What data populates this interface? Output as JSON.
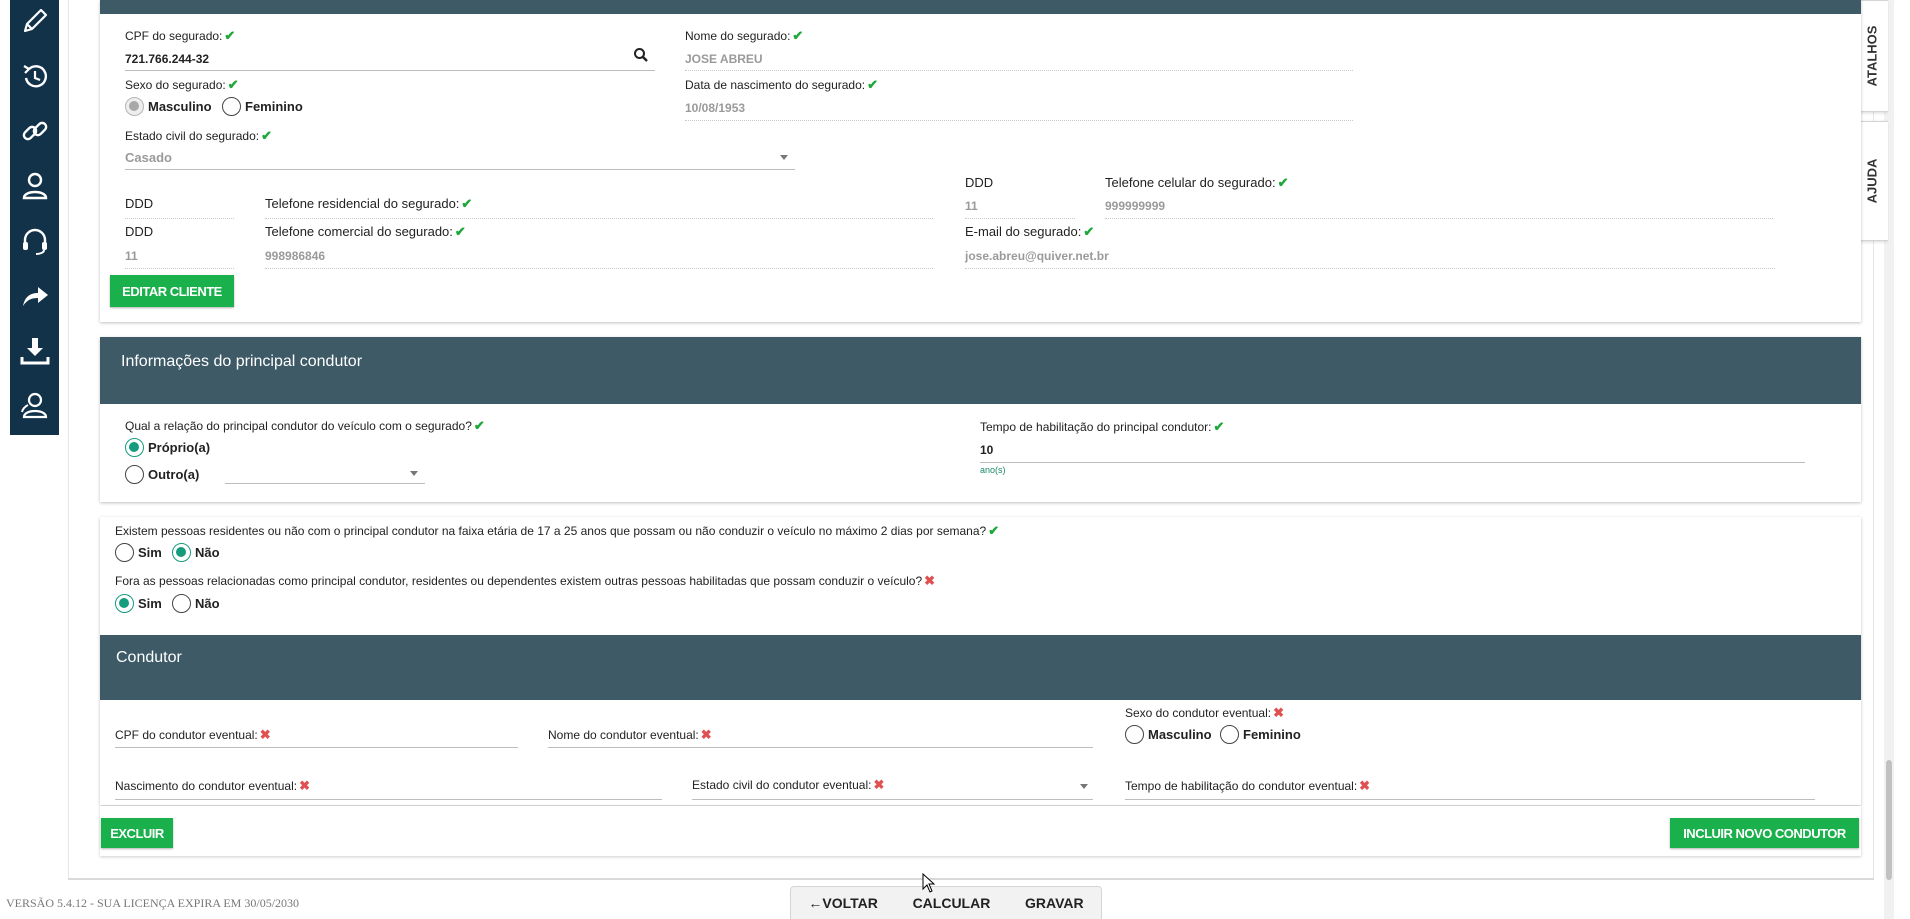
{
  "sidebar": {
    "icons": [
      "pencil-icon",
      "refresh-clock-icon",
      "link-icon",
      "user-icon",
      "headset-icon",
      "forward-arrow-icon",
      "download-icon",
      "users-icon"
    ]
  },
  "side_tabs": {
    "atalhos": "ATALHOS",
    "ajuda": "AJUDA"
  },
  "segurado": {
    "cpf_label": "CPF do segurado:",
    "cpf_value": "721.766.244-32",
    "nome_label": "Nome do segurado:",
    "nome_value": "JOSE ABREU",
    "sexo_label": "Sexo do segurado:",
    "sexo_masc": "Masculino",
    "sexo_fem": "Feminino",
    "nasc_label": "Data de nascimento do segurado:",
    "nasc_value": "10/08/1953",
    "estado_label": "Estado civil do segurado:",
    "estado_value": "Casado",
    "ddd_label": "DDD",
    "tel_res_label": "Telefone residencial do segurado:",
    "tel_cel_label": "Telefone celular do segurado:",
    "cel_ddd": "11",
    "cel_value": "999999999",
    "tel_com_label": "Telefone comercial do segurado:",
    "com_ddd": "11",
    "com_value": "998986846",
    "email_label": "E-mail do segurado:",
    "email_value": "jose.abreu@quiver.net.br",
    "edit_button": "EDITAR CLIENTE"
  },
  "condutor_principal": {
    "title": "Informações do principal condutor",
    "relacao_label": "Qual a relação do principal condutor do veículo com o segurado?",
    "proprio": "Próprio(a)",
    "outro": "Outro(a)",
    "tempo_label": "Tempo de habilitação do principal condutor:",
    "tempo_value": "10",
    "tempo_unit": "ano(s)"
  },
  "questions": {
    "q1": "Existem pessoas residentes ou não com o principal condutor na faixa etária de 17 a 25 anos que possam ou não conduzir o veículo no máximo 2 dias por semana?",
    "q2": "Fora as pessoas relacionadas como principal condutor, residentes ou dependentes existem outras pessoas habilitadas que possam conduzir o veículo?",
    "sim": "Sim",
    "nao": "Não"
  },
  "condutor": {
    "title": "Condutor",
    "cpf_label": "CPF do condutor eventual:",
    "nome_label": "Nome do condutor eventual:",
    "sexo_label": "Sexo do condutor eventual:",
    "masc": "Masculino",
    "fem": "Feminino",
    "nasc_label": "Nascimento do condutor eventual:",
    "estado_label": "Estado civil do condutor eventual:",
    "tempo_label": "Tempo de habilitação do condutor eventual:",
    "excluir": "EXCLUIR",
    "incluir": "INCLUIR NOVO CONDUTOR"
  },
  "marks": {
    "ok": "✔",
    "bad": "✖"
  },
  "footer": {
    "version": "VERSÃO 5.4.12 - SUA LICENÇA EXPIRA EM 30/05/2030",
    "voltar": "VOLTAR",
    "calcular": "CALCULAR",
    "gravar": "GRAVAR"
  }
}
